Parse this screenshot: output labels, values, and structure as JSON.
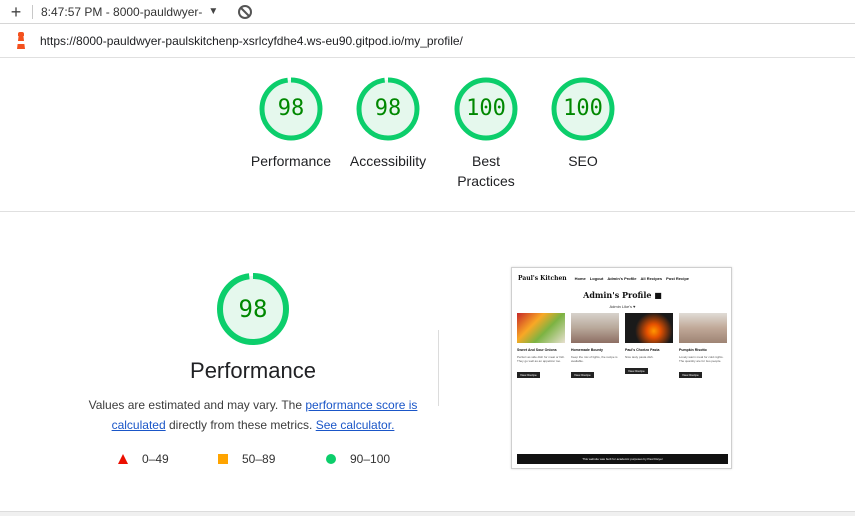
{
  "toolbar": {
    "report_label": "8:47:57 PM - 8000-pauldwyer-",
    "add_icon": "plus-icon",
    "clear_icon": "block-icon"
  },
  "url": "https://8000-pauldwyer-paulskitchenp-xsrlcyfdhe4.ws-eu90.gitpod.io/my_profile/",
  "categories": [
    {
      "score": "98",
      "value": 0.98,
      "label": "Performance"
    },
    {
      "score": "98",
      "value": 0.98,
      "label": "Accessibility"
    },
    {
      "score": "100",
      "value": 1.0,
      "label": "Best Practices"
    },
    {
      "score": "100",
      "value": 1.0,
      "label": "SEO"
    }
  ],
  "colors": {
    "pass": "#0cce6b",
    "pass_text": "#008800",
    "average": "#ffa400",
    "fail": "#eb0f00",
    "link": "#1a56c8"
  },
  "performance": {
    "score": "98",
    "value": 0.98,
    "title": "Performance",
    "desc_prefix": "Values are estimated and may vary. The ",
    "link_score": "performance score is calculated",
    "desc_mid": " directly from these metrics. ",
    "link_calc": "See calculator."
  },
  "legend": [
    {
      "range": "0–49",
      "shape": "triangle"
    },
    {
      "range": "50–89",
      "shape": "square"
    },
    {
      "range": "90–100",
      "shape": "circle"
    }
  ],
  "thumbnail": {
    "brand": "Paul's Kitchen",
    "nav": [
      "Home",
      "Logout",
      "Admin's Profile",
      "All Recipes",
      "Post Recipe"
    ],
    "page_title": "Admin's Profile",
    "likes": "Admin Like's",
    "cards": [
      {
        "title": "Sweet And Sour Onions",
        "desc": "Perfect as side dish for meat or fish. They go well as an appetizer too.",
        "button": "View Recipe"
      },
      {
        "title": "Homemade Bounty",
        "desc": "Keep the mix of lights, the recipe is available.",
        "button": "View Recipe"
      },
      {
        "title": "Paul's Chorizo Pasta",
        "desc": "Nice tasty pasta dish.",
        "button": "View Recipe"
      },
      {
        "title": "Pumpkin Risotto",
        "desc": "Lovely warm meal for cold nights. The quantity are for two people.",
        "button": "View Recipe"
      }
    ],
    "footer": "This website was built for academic purposes by Paul Dwyer"
  }
}
